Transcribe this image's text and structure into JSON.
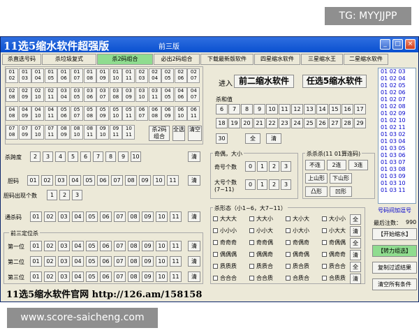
{
  "overlay": {
    "tg": "TG: MYYJJPP",
    "site": "www.score-saicheng.com"
  },
  "window": {
    "title": "11选5缩水软件超强版",
    "version": "前三版",
    "controls": [
      "_",
      "□",
      "×"
    ]
  },
  "tabs": [
    "杀直选号码",
    "杀垃圾复式",
    "杀2码组合",
    "必出2码组合",
    "下载最新版软件",
    "四星缩水软件",
    "三星缩水王",
    "二星缩水软件"
  ],
  "active_tab": 2,
  "pairs": [
    [
      "01 02",
      "01 03",
      "01 04",
      "01 05",
      "01 06",
      "01 07",
      "01 08",
      "01 09",
      "01 10",
      "01 11",
      "02 03",
      "02 04",
      "02 05",
      "02 06",
      "02 07"
    ],
    [
      "02 08",
      "02 09",
      "02 10",
      "02 11",
      "03 04",
      "03 05",
      "03 06",
      "03 07",
      "03 08",
      "03 09",
      "03 10",
      "03 11",
      "04 05",
      "04 06",
      "04 07"
    ],
    [
      "04 08",
      "04 09",
      "04 10",
      "04 11",
      "05 06",
      "05 07",
      "05 08",
      "05 09",
      "05 10",
      "05 11",
      "06 07",
      "06 08",
      "06 09",
      "06 10",
      "06 11"
    ],
    [
      "07 08",
      "07 09",
      "07 10",
      "07 11",
      "08 09",
      "08 10",
      "08 11",
      "09 10",
      "09 11",
      "10 11"
    ]
  ],
  "pairs_controls": {
    "kill": "杀2码组合",
    "all": "全选",
    "clear": "清空"
  },
  "span": {
    "label": "杀跨度",
    "values": [
      "2",
      "3",
      "4",
      "5",
      "6",
      "7",
      "8",
      "9",
      "10"
    ],
    "clear": "清"
  },
  "dan": {
    "label": "胆码",
    "values": [
      "01",
      "02",
      "03",
      "04",
      "05",
      "06",
      "07",
      "08",
      "09",
      "10",
      "11"
    ],
    "clear": "清"
  },
  "dan_count": {
    "label": "胆码出现个数",
    "values": [
      "1",
      "2",
      "3"
    ]
  },
  "tongsha": {
    "label": "通杀码",
    "values": [
      "01",
      "02",
      "03",
      "04",
      "05",
      "06",
      "07",
      "08",
      "09",
      "10",
      "11"
    ],
    "clear": "清"
  },
  "position": {
    "group_label": "前三定位杀",
    "rows": [
      {
        "label": "第一位"
      },
      {
        "label": "第二位"
      },
      {
        "label": "第三位"
      }
    ],
    "values": [
      "01",
      "02",
      "03",
      "04",
      "05",
      "06",
      "07",
      "08",
      "09",
      "10",
      "11"
    ],
    "clear": "清"
  },
  "enter": {
    "label": "进入",
    "btn1": "前二缩水软件",
    "btn2": "任选5缩水软件"
  },
  "sum": {
    "label": "杀和值",
    "values": [
      "6",
      "7",
      "8",
      "9",
      "10",
      "11",
      "12",
      "13",
      "14",
      "15",
      "16",
      "17",
      "18",
      "19",
      "20",
      "21",
      "22",
      "23",
      "24",
      "25",
      "26",
      "27",
      "28",
      "29",
      "30"
    ],
    "all": "全",
    "clear": "清"
  },
  "parity": {
    "group_label": "奇偶，大小",
    "odd_label": "奇号个数",
    "big_label": "大号个数",
    "big_note": "(7~11)",
    "values": [
      "0",
      "1",
      "2",
      "3"
    ]
  },
  "trend": {
    "group_label": "杀杀杀(11 01算连码)",
    "rows": [
      [
        "不连",
        "2连",
        "3连"
      ],
      [
        "上山形",
        "下山形"
      ],
      [
        "凸形",
        "凹形"
      ]
    ]
  },
  "shape": {
    "group_label": "杀形态（小1~6，大7~11）",
    "rows": [
      [
        "大大大",
        "大大小",
        "大小大",
        "大小小"
      ],
      [
        "小小小",
        "小小大",
        "小大小",
        "小大大"
      ],
      [
        "奇奇奇",
        "奇奇偶",
        "奇偶奇",
        "奇偶偶"
      ],
      [
        "偶偶偶",
        "偶偶奇",
        "偶奇偶",
        "偶奇奇"
      ],
      [
        "质质质",
        "质质合",
        "质合质",
        "质合合"
      ],
      [
        "合合合",
        "合合质",
        "合质合",
        "合质质"
      ]
    ],
    "all": "全",
    "clear": "清"
  },
  "listbox": {
    "items": [
      "01 02 03",
      "01 02 04",
      "01 02 05",
      "01 02 06",
      "01 02 07",
      "01 02 08",
      "01 02 09",
      "01 02 10",
      "01 02 11",
      "01 03 02",
      "01 03 04",
      "01 03 05",
      "01 03 06",
      "01 03 07",
      "01 03 08",
      "01 03 09",
      "01 03 10",
      "01 03 11"
    ]
  },
  "side": {
    "note": "号码间加逗号",
    "count_label": "最后注数：",
    "count_value": "990",
    "start": "【开始缩水】",
    "force": "【转力组选】",
    "copy": "复制过滤结果",
    "clear_all": "清空所有条件"
  },
  "footer": {
    "text": "11选5缩水软件官网  http://126.am/158158"
  },
  "colors": {
    "title_bar": "#0a50d0",
    "window_bg": "#ece9d8",
    "active_tab": "#8fdc8f",
    "list_text": "#0000cc"
  }
}
